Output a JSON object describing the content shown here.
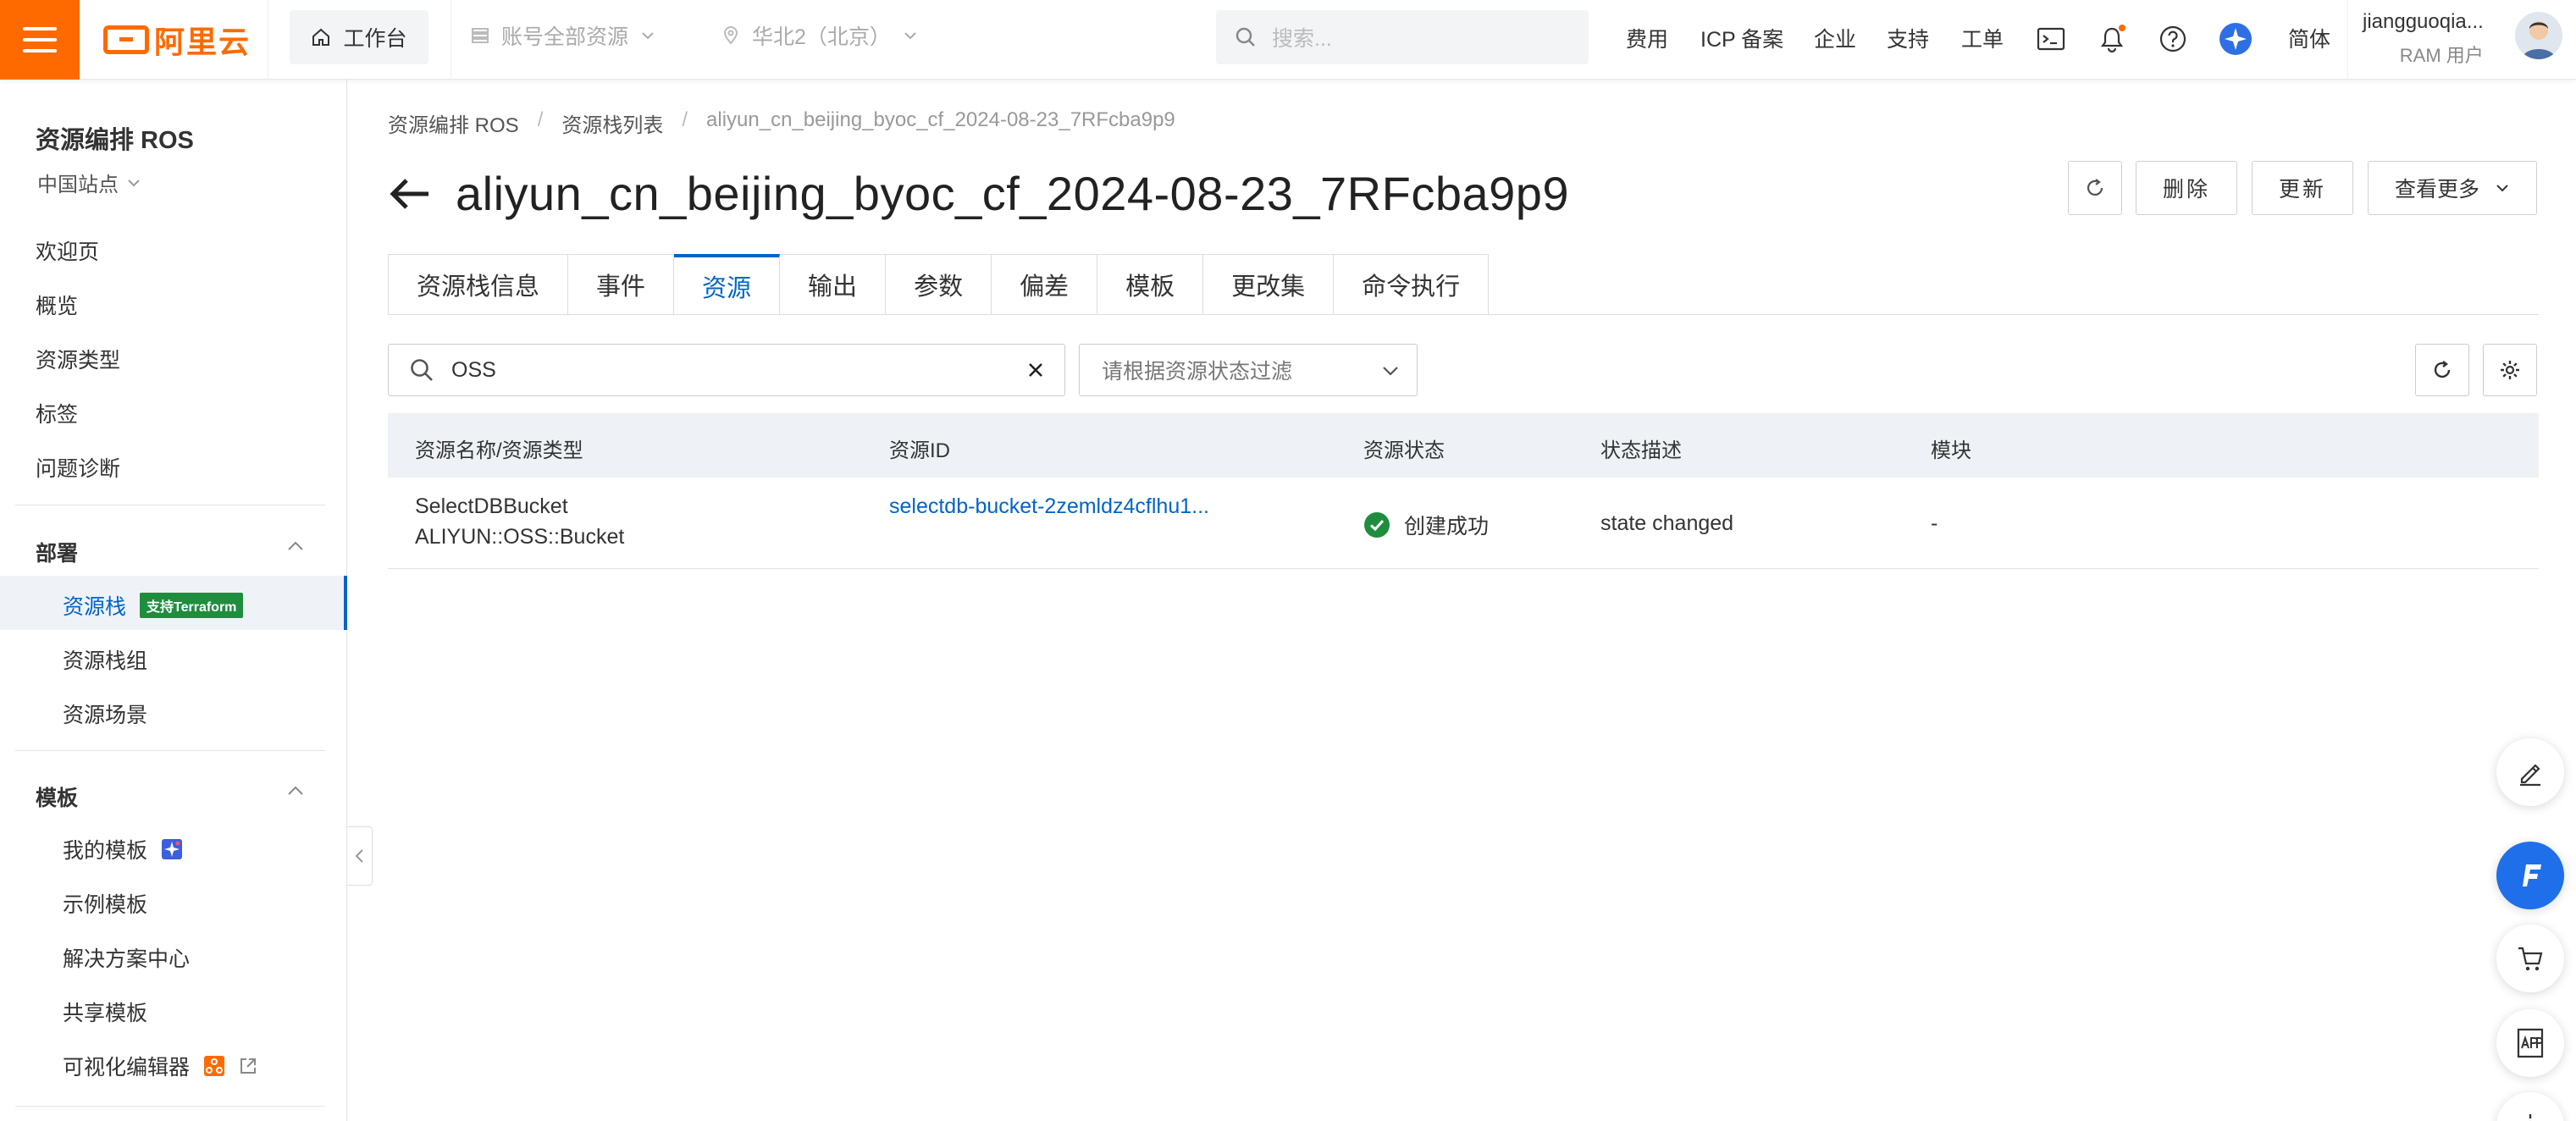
{
  "topbar": {
    "logo_text": "阿里云",
    "workbench": "工作台",
    "resource_scope": "账号全部资源",
    "region": "华北2（北京）",
    "search_placeholder": "搜索...",
    "links": {
      "billing": "费用",
      "icp": "ICP 备案",
      "enterprise": "企业",
      "support": "支持",
      "ticket": "工单",
      "lang": "简体"
    },
    "notification_dot_color": "#ff6a00",
    "user_name": "jiangguoqia...",
    "user_role": "RAM 用户"
  },
  "sidebar": {
    "title": "资源编排 ROS",
    "site": "中国站点",
    "top_items": [
      "欢迎页",
      "概览",
      "资源类型",
      "标签",
      "问题诊断"
    ],
    "deploy_group": "部署",
    "deploy_items": {
      "stack": "资源栈",
      "stack_badge": "支持Terraform",
      "stack_group": "资源栈组",
      "scenario": "资源场景"
    },
    "template_group": "模板",
    "template_items": {
      "my": "我的模板",
      "sample": "示例模板",
      "solution": "解决方案中心",
      "shared": "共享模板",
      "visual": "可视化编辑器"
    }
  },
  "breadcrumb": {
    "root": "资源编排 ROS",
    "list": "资源栈列表",
    "current": "aliyun_cn_beijing_byoc_cf_2024-08-23_7RFcba9p9",
    "sep": "/"
  },
  "page": {
    "title": "aliyun_cn_beijing_byoc_cf_2024-08-23_7RFcba9p9",
    "actions": {
      "delete": "删除",
      "update": "更新",
      "more": "查看更多"
    }
  },
  "tabs": [
    "资源栈信息",
    "事件",
    "资源",
    "输出",
    "参数",
    "偏差",
    "模板",
    "更改集",
    "命令执行"
  ],
  "active_tab": "资源",
  "filter": {
    "search_value": "OSS",
    "status_placeholder": "请根据资源状态过滤"
  },
  "table": {
    "headers": {
      "name": "资源名称/资源类型",
      "id": "资源ID",
      "status": "资源状态",
      "reason": "状态描述",
      "module": "模块"
    },
    "rows": [
      {
        "name": "SelectDBBucket",
        "type": "ALIYUN::OSS::Bucket",
        "id": "selectdb-bucket-2zemldz4cflhu1...",
        "status": "创建成功",
        "reason": "state changed",
        "module": "-"
      }
    ]
  },
  "colors": {
    "brand": "#ff6a00",
    "accent": "#0064c8",
    "success": "#1e8e3e"
  }
}
